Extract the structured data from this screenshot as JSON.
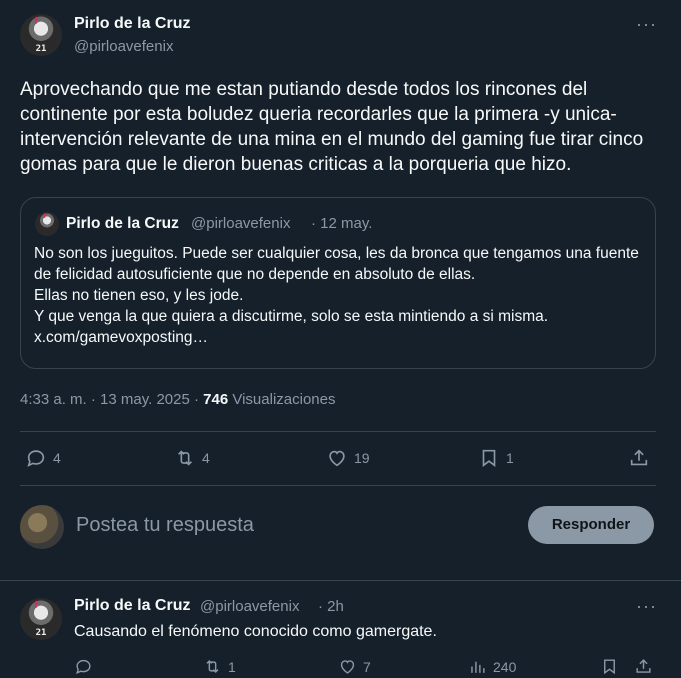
{
  "tweet": {
    "author_name": "Pirlo de la Cruz",
    "author_handle": "@pirloavefenix",
    "avatar_number": "21",
    "more_label": "···",
    "text": "Aprovechando que me estan putiando desde todos los rincones del continente por esta boludez queria recordarles que la primera -y unica- intervención relevante de una mina en el mundo del gaming fue tirar cinco gomas para que le dieron buenas criticas a la porqueria que hizo.",
    "quote": {
      "author_name": "Pirlo de la Cruz",
      "author_handle": "@pirloavefenix",
      "date": "· 12 may.",
      "text": "No son los jueguitos. Puede ser cualquier cosa, les da bronca que tengamos una fuente de felicidad autosuficiente que no depende en absoluto de ellas.\nEllas no tienen eso, y les jode.\nY que venga la que quiera a discutirme, solo se esta mintiendo a si misma.\nx.com/gamevoxposting…"
    },
    "time": "4:33 a. m. · 13 may. 2025 ·",
    "views_count": "746",
    "views_label": "Visualizaciones",
    "actions": {
      "replies": "4",
      "retweets": "4",
      "likes": "19",
      "bookmarks": "1"
    }
  },
  "composer": {
    "placeholder": "Postea tu respuesta",
    "button_label": "Responder"
  },
  "reply": {
    "author_name": "Pirlo de la Cruz",
    "author_handle": "@pirloavefenix",
    "time": "· 2h",
    "text": "Causando el fenómeno conocido como gamergate.",
    "actions": {
      "replies": "",
      "retweets": "1",
      "likes": "7",
      "views": "240"
    }
  }
}
